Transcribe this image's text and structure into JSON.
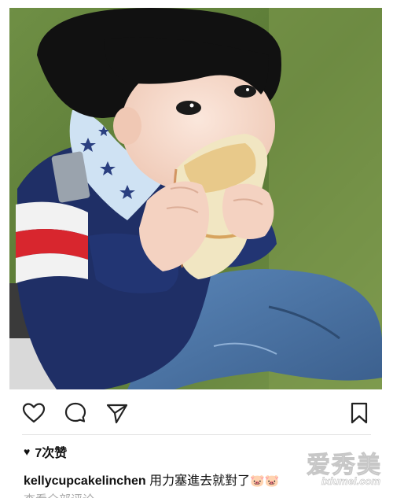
{
  "post": {
    "likes_text": "7次赞",
    "username": "kellycupcakelinchen",
    "caption_text": "用力塞進去就對了",
    "caption_emoji": "🐷🐷",
    "more_text": "查看全部评论"
  },
  "icons": {
    "like": "heart-icon",
    "comment": "comment-icon",
    "share": "share-icon",
    "save": "bookmark-icon",
    "likes_glyph": "heart-filled-icon"
  },
  "watermark": {
    "chinese": "爱秀美",
    "url": "ixiumei.com"
  },
  "colors": {
    "text": "#111111",
    "icon_stroke": "#222222",
    "divider": "#e3e3e3"
  }
}
